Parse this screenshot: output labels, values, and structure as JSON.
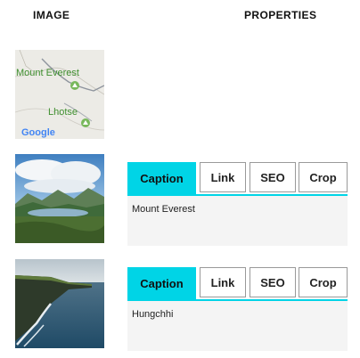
{
  "header": {
    "image_label": "IMAGE",
    "properties_label": "PROPERTIES"
  },
  "rows": [
    {
      "thumb": "map-thumbnail",
      "map_labels": [
        "Mount Everest",
        "Lhotse"
      ],
      "map_brand": "Google"
    },
    {
      "thumb": "mountain-lake-photo",
      "tabs": [
        "Caption",
        "Link",
        "SEO",
        "Crop"
      ],
      "active_tab": "Caption",
      "caption_value": "Mount Everest"
    },
    {
      "thumb": "sea-cliffs-photo",
      "tabs": [
        "Caption",
        "Link",
        "SEO",
        "Crop"
      ],
      "active_tab": "Caption",
      "caption_value": "Hungchhi"
    }
  ],
  "colors": {
    "accent": "#00d4e6",
    "caption_bg": "#f4f4f4"
  }
}
